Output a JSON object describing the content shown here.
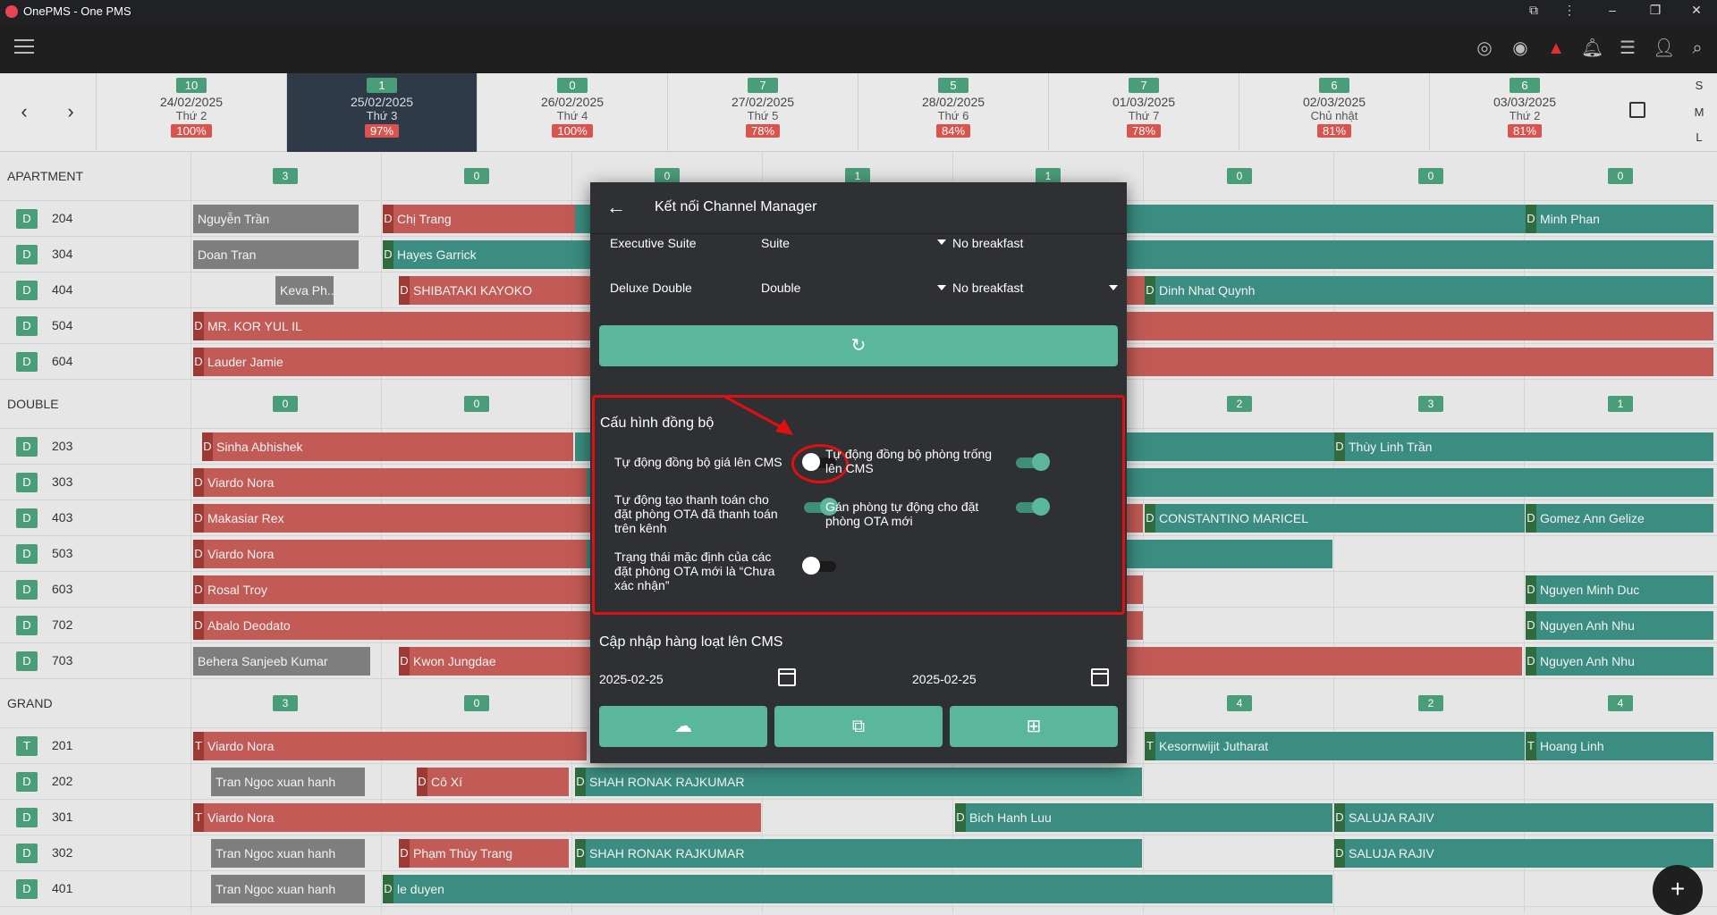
{
  "window": {
    "title": "OnePMS - One PMS"
  },
  "dates": [
    {
      "count": "10",
      "date": "24/02/2025",
      "weekday": "Thứ 2",
      "occ": "100%"
    },
    {
      "count": "1",
      "date": "25/02/2025",
      "weekday": "Thứ 3",
      "occ": "97%"
    },
    {
      "count": "0",
      "date": "26/02/2025",
      "weekday": "Thứ 4",
      "occ": "100%"
    },
    {
      "count": "7",
      "date": "27/02/2025",
      "weekday": "Thứ 5",
      "occ": "78%"
    },
    {
      "count": "5",
      "date": "28/02/2025",
      "weekday": "Thứ 6",
      "occ": "84%"
    },
    {
      "count": "7",
      "date": "01/03/2025",
      "weekday": "Thứ 7",
      "occ": "78%"
    },
    {
      "count": "6",
      "date": "02/03/2025",
      "weekday": "Chủ nhật",
      "occ": "81%"
    },
    {
      "count": "6",
      "date": "03/03/2025",
      "weekday": "Thứ 2",
      "occ": "81%"
    }
  ],
  "size_opts": [
    "S",
    "M",
    "L"
  ],
  "groups": {
    "apartment": {
      "name": "APARTMENT",
      "badges": [
        "3",
        "0",
        "0",
        "1",
        "1",
        "0",
        "0",
        "0"
      ]
    },
    "double": {
      "name": "DOUBLE",
      "badges": [
        "0",
        "0",
        "2",
        "3",
        "1"
      ]
    },
    "grand": {
      "name": "GRAND",
      "badges": [
        "3",
        "0",
        "4",
        "2",
        "4"
      ]
    }
  },
  "rooms": [
    {
      "type": "D",
      "no": "204"
    },
    {
      "type": "D",
      "no": "304"
    },
    {
      "type": "D",
      "no": "404"
    },
    {
      "type": "D",
      "no": "504"
    },
    {
      "type": "D",
      "no": "604"
    },
    {
      "type": "D",
      "no": "203"
    },
    {
      "type": "D",
      "no": "303"
    },
    {
      "type": "D",
      "no": "403"
    },
    {
      "type": "D",
      "no": "503"
    },
    {
      "type": "D",
      "no": "603"
    },
    {
      "type": "D",
      "no": "702"
    },
    {
      "type": "D",
      "no": "703"
    },
    {
      "type": "T",
      "no": "201"
    },
    {
      "type": "D",
      "no": "202"
    },
    {
      "type": "D",
      "no": "301"
    },
    {
      "type": "D",
      "no": "302"
    },
    {
      "type": "D",
      "no": "401"
    }
  ],
  "bookings": {
    "b1": "Nguyễn Trần",
    "b2": "Chị Trang",
    "b3": "Minh Phan",
    "b4": "Doan Tran",
    "b5": "Hayes Garrick",
    "b6": "Keva Ph...",
    "b7": "SHIBATAKI KAYOKO",
    "b8": "Dinh Nhat Quynh",
    "b9": "MR. KOR YUL IL",
    "b10": "Lauder Jamie",
    "b11": "Sinha Abhishek",
    "b12": "Thùy Linh Trần",
    "b13": "Viardo Nora",
    "b14": "Makasiar Rex",
    "b15": "CONSTANTINO MARICEL",
    "b16": "Gomez Ann Gelize",
    "b17": "Viardo Nora",
    "b18": "Rosal Troy",
    "b19": "Nguyen Minh Duc",
    "b20": "Abalo Deodato",
    "b21": "Nguyen Anh Nhu",
    "b22": "Behera Sanjeeb Kumar",
    "b23": "Kwon Jungdae",
    "b24": "Nguyen Anh Nhu",
    "b25": "Viardo Nora",
    "b26": "Kesornwijit Jutharat",
    "b27": "Hoang Linh",
    "b28": "Tran Ngoc xuan hanh",
    "b29": "Cô Xí",
    "b30": "SHAH RONAK RAJKUMAR",
    "b31": "Viardo Nora",
    "b32": "Bich Hanh Luu",
    "b33": "SALUJA RAJIV",
    "b34": "Tran Ngoc xuan hanh",
    "b35": "Phạm Thùy Trang",
    "b36": "SHAH RONAK RAJKUMAR",
    "b37": "SALUJA RAJIV",
    "b38": "Tran Ngoc xuan hanh",
    "b39": "le duyen"
  },
  "modal": {
    "title": "Kết nối Channel Manager",
    "mappings": [
      {
        "room": "Executive Suite",
        "type": "Suite",
        "meal": "No breakfast"
      },
      {
        "room": "Deluxe Double",
        "type": "Double",
        "meal": "No breakfast"
      }
    ],
    "sync_title": "Cấu hình đồng bộ",
    "opt1": "Tự động đồng bộ giá lên CMS",
    "opt2": "Tự động đồng bộ phòng trống lên CMS",
    "opt3": "Tự động tạo thanh toán cho đặt phòng OTA đã thanh toán trên kênh",
    "opt4": "Gán phòng tự động cho đặt phòng OTA mới",
    "opt5": "Trạng thái mặc định của các đặt phòng OTA mới là “Chưa xác nhận”",
    "bulk_title": "Cập nhập hàng loạt lên CMS",
    "from": "2025-02-25",
    "to": "2025-02-25"
  },
  "toggles": {
    "opt1": 0,
    "opt2": 1,
    "opt3": 1,
    "opt4": 1,
    "opt5": 0
  }
}
